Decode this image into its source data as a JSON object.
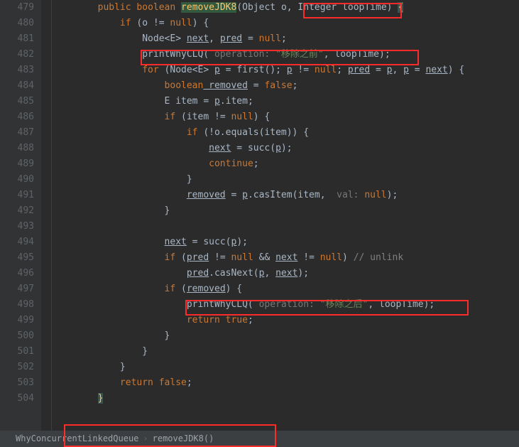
{
  "gutter": {
    "start": 479,
    "end": 504
  },
  "code": {
    "kw_public": "public",
    "kw_boolean": "boolean",
    "method_name": "removeJDK8",
    "param_obj": "(Object o,",
    "param_int": " Integer loopTime",
    "sig_close": ") ",
    "brace_open": "{",
    "l480_if": "if",
    "l480_cond": " (o != ",
    "l480_null": "null",
    "l480_close": ") {",
    "l481_node": "Node<",
    "l481_e": "E",
    "l481_close": "> ",
    "l481_next": "next",
    "l481_comma": ", ",
    "l481_pred": "pred",
    "l481_eq": " = ",
    "l481_null": "null",
    "l481_semi": ";",
    "l482_call": "printWhyCLQ(",
    "l482_hint": " operation: ",
    "l482_str": "\"移除之前\"",
    "l482_rest": ", loopTime);",
    "l483_for": "for",
    "l483_open": " (Node<",
    "l483_e": "E",
    "l483_close": "> ",
    "l483_p": "p",
    "l483_eqfirst": " = first(); ",
    "l483_p2": "p",
    "l483_ne": " != ",
    "l483_null": "null",
    "l483_semi": "; ",
    "l483_pred": "pred",
    "l483_eq": " = ",
    "l483_p3": "p",
    "l483_comma2": ", ",
    "l483_p4": "p",
    "l483_eq2": " = ",
    "l483_next": "next",
    "l483_tail": ") {",
    "l484_bool": "boolean",
    "l484_removed": " removed",
    "l484_eq": " = ",
    "l484_false": "false",
    "l484_semi": ";",
    "l485_e": "E",
    "l485_item": " item = ",
    "l485_p": "p",
    "l485_rest": ".item;",
    "l486_if": "if",
    "l486_rest": " (item != ",
    "l486_null": "null",
    "l486_close": ") {",
    "l487_if": "if",
    "l487_rest": " (!o.equals(item)) {",
    "l488_next": "next",
    "l488_eq": " = succ(",
    "l488_p": "p",
    "l488_close": ");",
    "l489_cont": "continue",
    "l489_semi": ";",
    "l490_close": "}",
    "l491_removed": "removed",
    "l491_eq": " = ",
    "l491_p": "p",
    "l491_cas": ".casItem(item, ",
    "l491_hint": " val: ",
    "l491_null": "null",
    "l491_close": ");",
    "l492_close": "}",
    "l494_next": "next",
    "l494_eq": " = succ(",
    "l494_p": "p",
    "l494_close": ");",
    "l495_if": "if",
    "l495_open": " (",
    "l495_pred": "pred",
    "l495_ne": " != ",
    "l495_null": "null",
    "l495_and": " && ",
    "l495_next": "next",
    "l495_ne2": " != ",
    "l495_null2": "null",
    "l495_close": ") ",
    "l495_cmt": "// unlink",
    "l496_pred": "pred",
    "l496_dot": ".casNext(",
    "l496_p": "p",
    "l496_comma": ", ",
    "l496_next": "next",
    "l496_close": ");",
    "l497_if": "if",
    "l497_open": " (",
    "l497_removed": "removed",
    "l497_close": ") {",
    "l498_call": "printWhyCLQ(",
    "l498_hint": " operation: ",
    "l498_str": "\"移除之后\"",
    "l498_rest": ", loopTime);",
    "l499_return": "return ",
    "l499_true": "true",
    "l499_semi": ";",
    "l500_close": "}",
    "l501_close": "}",
    "l502_close": "}",
    "l503_return": "return ",
    "l503_false": "false",
    "l503_semi": ";",
    "l504_close": "}"
  },
  "breadcrumb": {
    "cls": "WhyConcurrentLinkedQueue",
    "mtd": "removeJDK8()"
  }
}
